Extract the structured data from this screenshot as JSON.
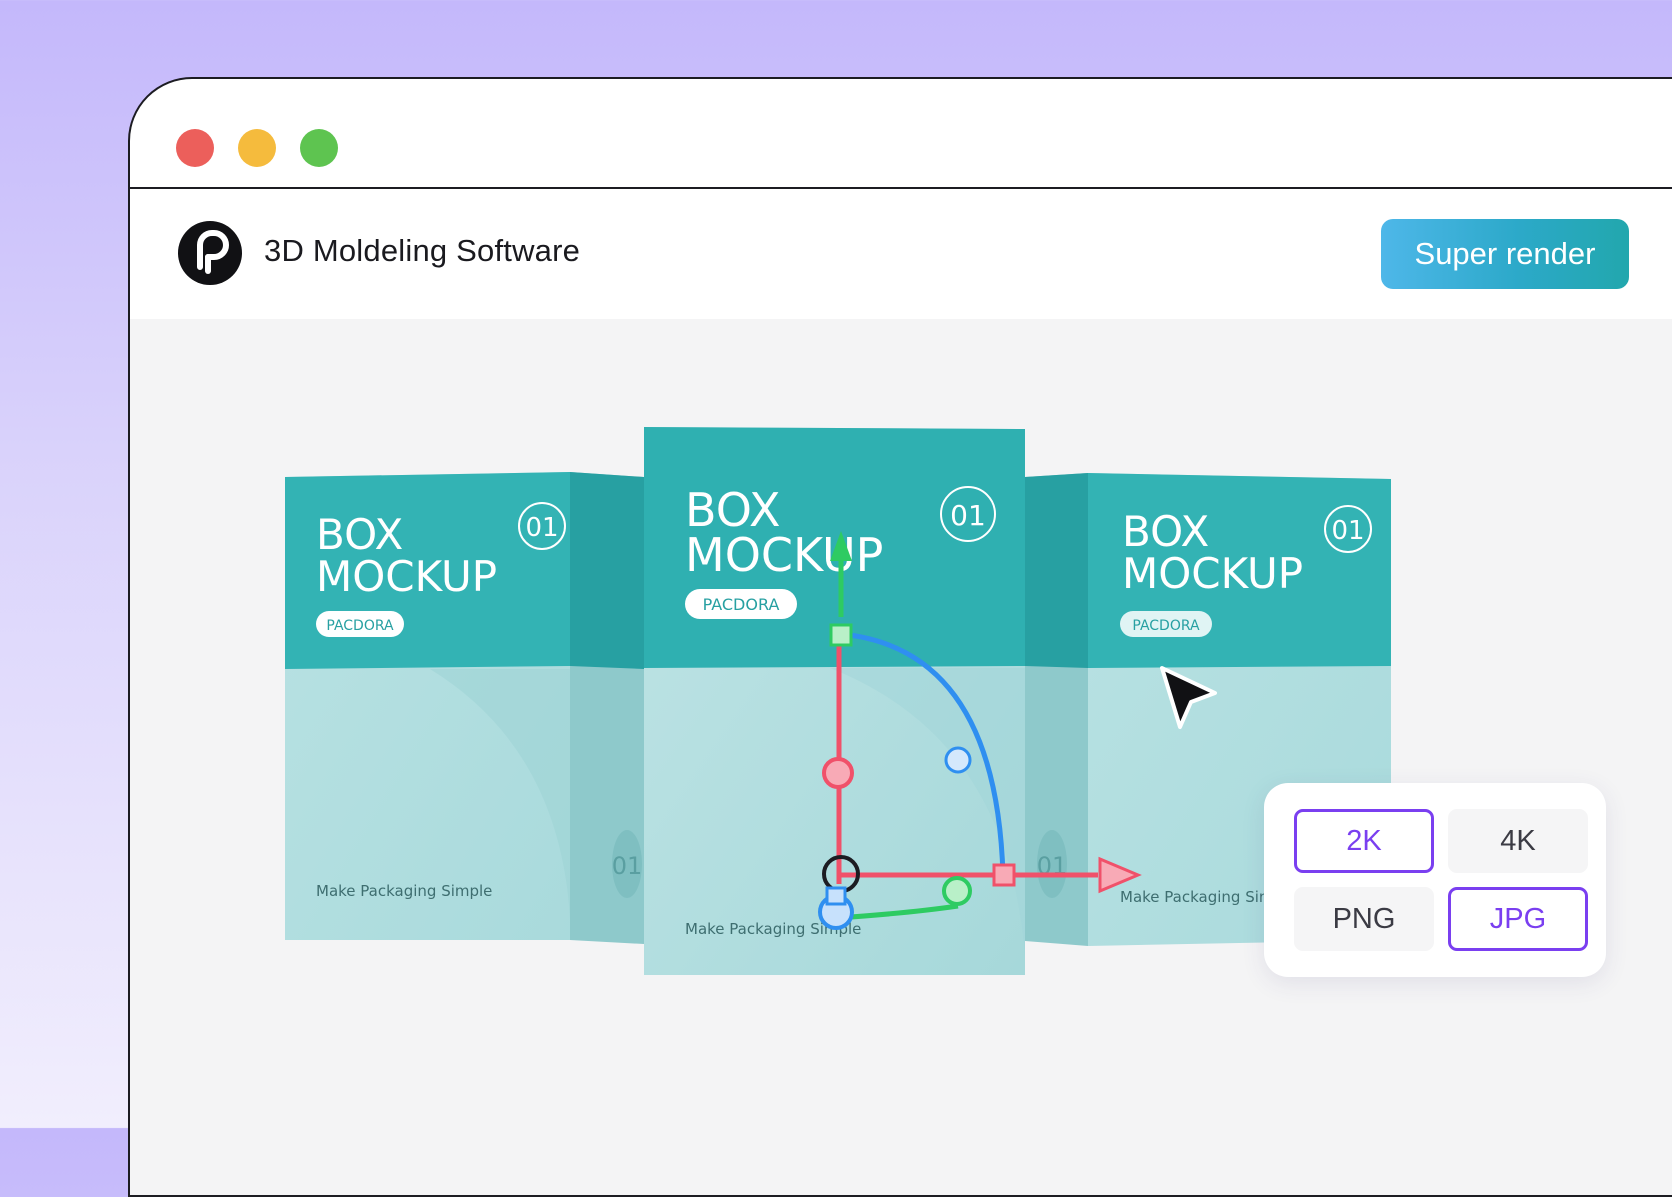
{
  "app": {
    "title": "3D Moldeling Software"
  },
  "toolbar": {
    "render_label": "Super render"
  },
  "boxes": {
    "left": {
      "line1": "BOX",
      "line2": "MOCKUP",
      "badge": "01",
      "brand": "PACDORA",
      "tagline": "Make Packaging Simple",
      "side_number": "01"
    },
    "center": {
      "line1": "BOX",
      "line2": "MOCKUP",
      "badge": "01",
      "brand": "PACDORA",
      "tagline": "Make Packaging Simple"
    },
    "right": {
      "line1": "BOX",
      "line2": "MOCKUP",
      "badge": "01",
      "brand": "PACDORA",
      "tagline": "Make Packaging Simple",
      "side_number": "01"
    }
  },
  "render_options": {
    "resolution": [
      "2K",
      "4K"
    ],
    "format": [
      "PNG",
      "JPG"
    ],
    "selected_resolution": "2K",
    "selected_format": "JPG"
  },
  "colors": {
    "accent": "#7a3ff0",
    "render_button": "#2ca9c9",
    "box_teal": "#2fb0b1",
    "axis_x": "#f0516a",
    "axis_y": "#2ecb62",
    "axis_z": "#2f8ff0"
  },
  "icons": {
    "logo": "pacdora-logo-icon",
    "cursor": "cursor-arrow-icon"
  }
}
